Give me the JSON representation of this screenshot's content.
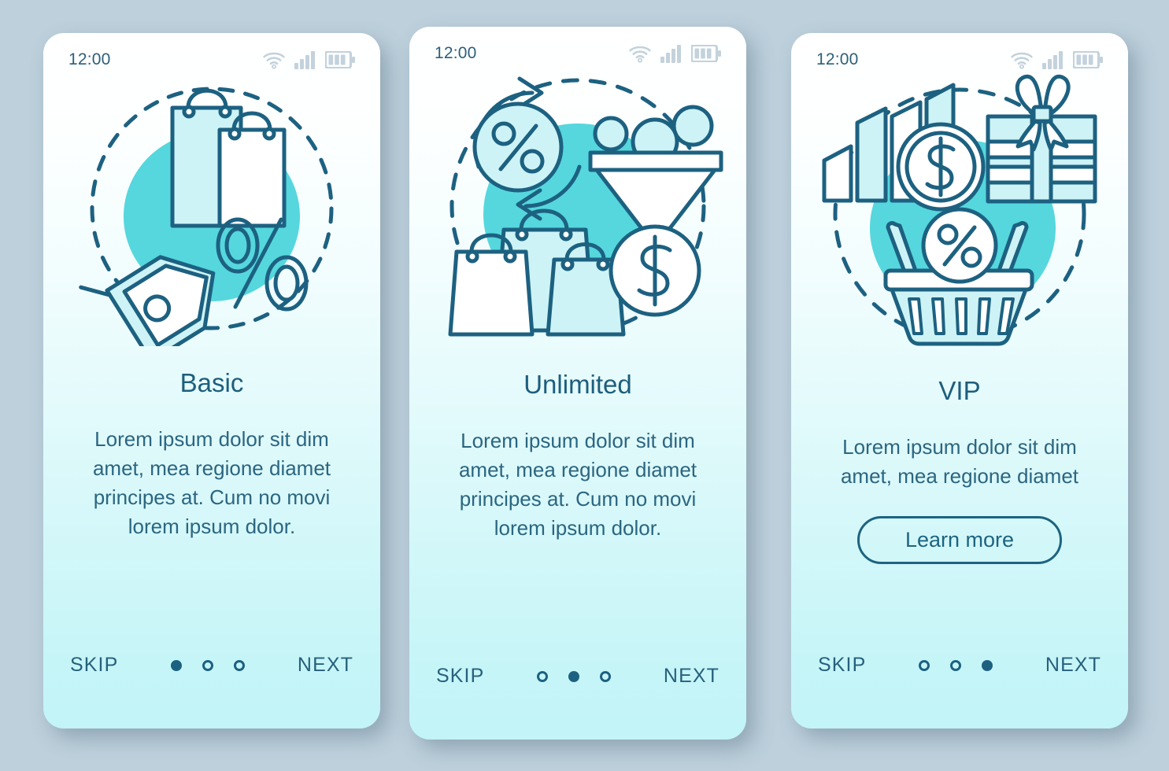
{
  "theme": {
    "page_background": "#bdd0dc",
    "accent_dark": "#1d6181",
    "accent_turquoise": "#55d7dd",
    "fill_light": "#cdf3f6",
    "card_gradient_top": "#ffffff",
    "card_gradient_bottom": "#c2f4f8",
    "status_icon_color": "#c3d2dc"
  },
  "status_bar": {
    "time": "12:00",
    "icons": [
      "wifi-icon",
      "cellular-signal-icon",
      "battery-icon"
    ]
  },
  "screens": [
    {
      "id": "basic",
      "illustration_name": "shopping-bags-price-tag-percent-illustration",
      "illustration_elements": [
        "shopping-bag",
        "shopping-bag",
        "price-tag",
        "percent-symbol",
        "dashed-circle",
        "turquoise-blob"
      ],
      "title": "Basic",
      "body": "Lorem ipsum dolor sit dim amet, mea regione diamet principes at. Cum no movi lorem ipsum dolor.",
      "cta": null,
      "skip_label": "SKIP",
      "next_label": "NEXT",
      "dots": [
        true,
        false,
        false
      ]
    },
    {
      "id": "unlimited",
      "illustration_name": "refresh-percent-funnel-bags-dollar-illustration",
      "illustration_elements": [
        "refresh-arrows",
        "percent-circle",
        "funnel",
        "shopping-bag",
        "shopping-bag",
        "shopping-bag",
        "dollar-coin",
        "dashed-circle",
        "turquoise-blob"
      ],
      "title": "Unlimited",
      "body": "Lorem ipsum dolor sit dim amet, mea regione diamet principes at. Cum no movi lorem ipsum dolor.",
      "cta": null,
      "skip_label": "SKIP",
      "next_label": "NEXT",
      "dots": [
        false,
        true,
        false
      ]
    },
    {
      "id": "vip",
      "illustration_name": "growth-bars-coin-gift-basket-illustration",
      "illustration_elements": [
        "growth-bar-chart",
        "dollar-coin",
        "gift-box-with-bow",
        "shopping-basket",
        "percent-circle",
        "dashed-circle",
        "turquoise-blob"
      ],
      "title": "VIP",
      "body": "Lorem ipsum dolor sit dim amet, mea regione diamet",
      "cta": "Learn more",
      "skip_label": "SKIP",
      "next_label": "NEXT",
      "dots": [
        false,
        false,
        true
      ]
    }
  ]
}
